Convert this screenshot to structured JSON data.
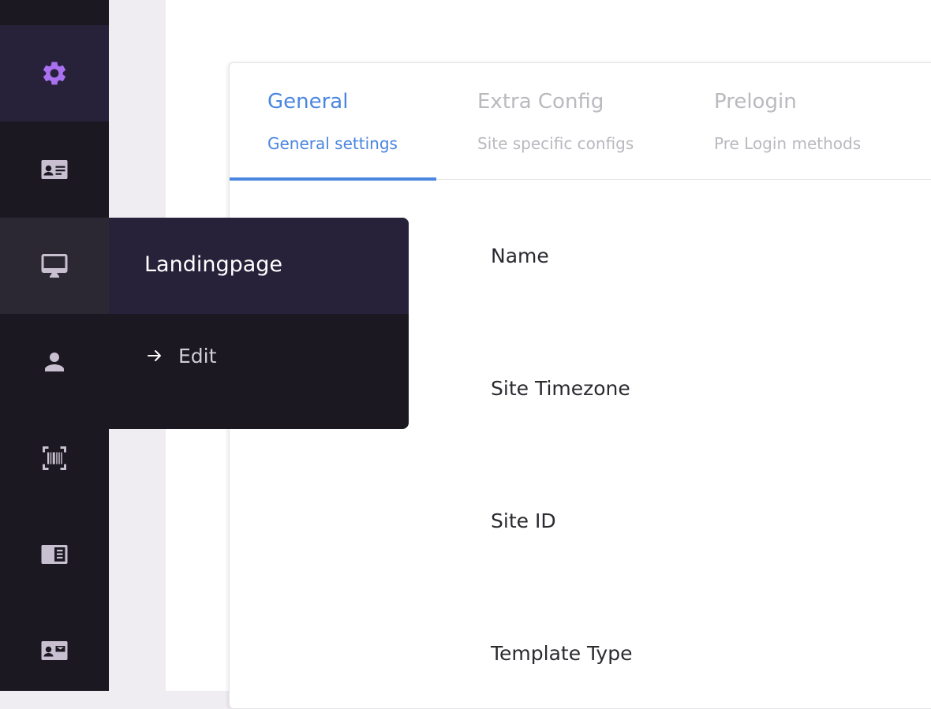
{
  "sidebar": {
    "items": [
      {
        "icon": "gear-icon",
        "state": "active"
      },
      {
        "icon": "id-card-icon",
        "state": "normal"
      },
      {
        "icon": "monitor-icon",
        "state": "hover"
      },
      {
        "icon": "user-icon",
        "state": "normal"
      },
      {
        "icon": "barcode-scan-icon",
        "state": "normal"
      },
      {
        "icon": "page-layout-icon",
        "state": "normal"
      },
      {
        "icon": "contact-mail-icon",
        "state": "normal"
      }
    ],
    "active_color": "#a970ef",
    "icon_color": "#c8c0d0"
  },
  "flyout": {
    "title": "Landingpage",
    "links": [
      {
        "icon": "arrow-right-icon",
        "label": "Edit"
      }
    ]
  },
  "tabs": [
    {
      "title": "General",
      "subtitle": "General settings",
      "active": true
    },
    {
      "title": "Extra Config",
      "subtitle": "Site specific configs",
      "active": false
    },
    {
      "title": "Prelogin",
      "subtitle": "Pre Login methods",
      "active": false
    }
  ],
  "form": {
    "labels": [
      "Name",
      "Site Timezone",
      "Site ID",
      "Template Type"
    ]
  },
  "colors": {
    "accent": "#4a86e0",
    "sidebar_bg": "#1b1822",
    "sidebar_active_bg": "#27223a",
    "inactive_tab_text": "#b9b9bf"
  }
}
